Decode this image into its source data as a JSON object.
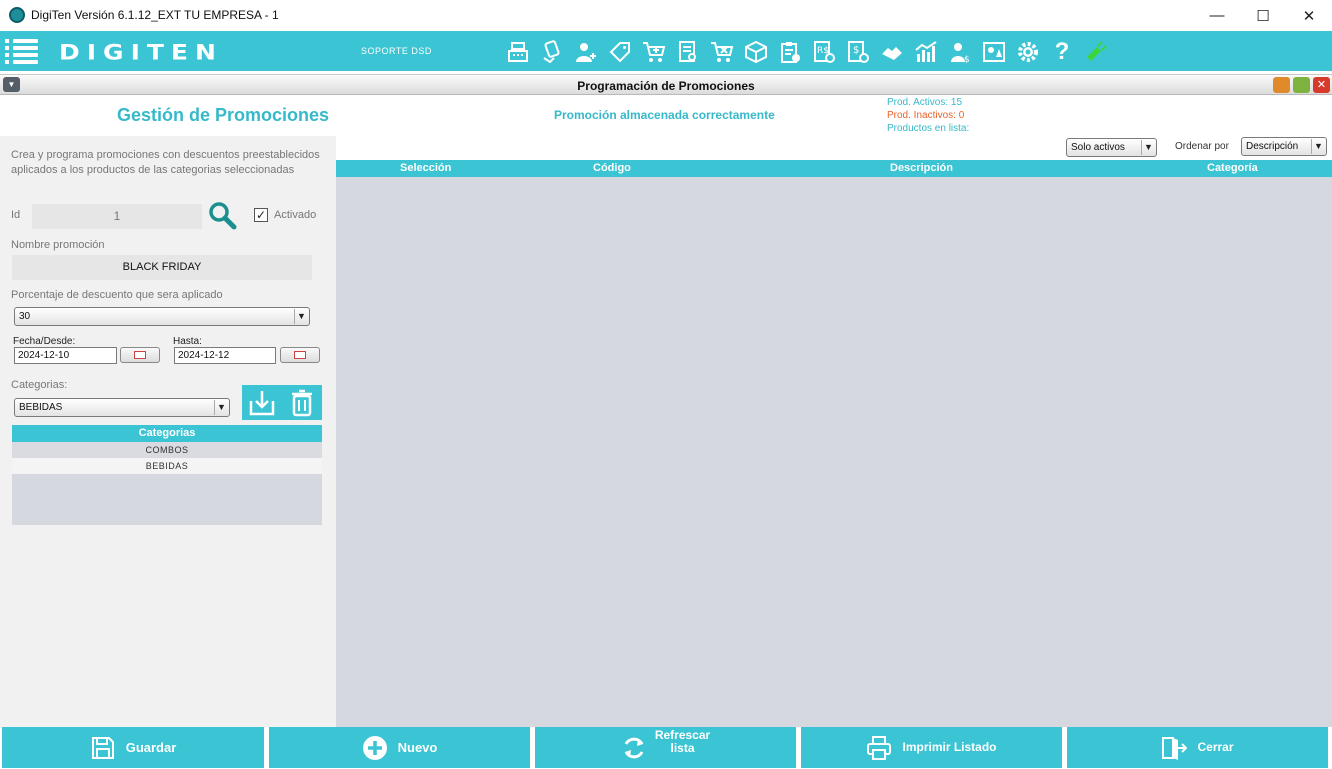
{
  "window": {
    "title": "DigiTen Versión 6.1.12_EXT TU EMPRESA - 1",
    "minimize": "—",
    "maximize": "☐",
    "close": "✕"
  },
  "toolbar": {
    "logo": "DIGITEN",
    "support": "SOPORTE DSD",
    "icons": [
      "cash-register-icon",
      "payment-icon",
      "user-add-icon",
      "tag-icon",
      "cart-add-icon",
      "invoice-search-icon",
      "cart-cancel-icon",
      "box-icon",
      "clipboard-check-icon",
      "receipt-add-icon",
      "bill-add-icon",
      "handshake-icon",
      "stats-chart-icon",
      "user-money-icon",
      "dashboard-icon",
      "gear-icon",
      "help-icon",
      "connection-icon"
    ]
  },
  "subwindow": {
    "title": "Programación de Promociones"
  },
  "left": {
    "title": "Gestión de Promociones",
    "description": "Crea y programa promociones con descuentos preestablecidos aplicados a los productos de las categorias seleccionadas",
    "id_label": "Id",
    "id_value": "1",
    "active_label": "Activado",
    "active_checked": true,
    "name_label": "Nombre promoción",
    "name_value": "BLACK FRIDAY",
    "discount_label": "Porcentaje de descuento que sera aplicado",
    "discount_value": "30",
    "from_label": "Fecha/Desde:",
    "from_value": "2024-12-10",
    "to_label": "Hasta:",
    "to_value": "2024-12-12",
    "categories_label": "Categorias:",
    "category_selected": "BEBIDAS",
    "categories_header": "Categorias",
    "categories": [
      "COMBOS",
      "BEBIDAS"
    ]
  },
  "main": {
    "status_message": "Promoción almacenada correctamente",
    "stats": {
      "active": "Prod. Activos: 15",
      "inactive": "Prod. Inactivos: 0",
      "in_list": "Productos en lista:"
    },
    "filter_value": "Solo activos",
    "order_label": "Ordenar por",
    "order_value": "Descripción",
    "columns": [
      "Selección",
      "Código",
      "Descripción",
      "Categoría"
    ]
  },
  "bottom": {
    "save": "Guardar",
    "new": "Nuevo",
    "refresh_1": "Refrescar",
    "refresh_2": "lista",
    "print": "Imprimir Listado",
    "close": "Cerrar"
  },
  "colors": {
    "accent": "#3bc4d3",
    "title_teal": "#36b9c9",
    "active_stat": "#36b9c9",
    "inactive_stat": "#e8632b",
    "search_icon": "#1a8f8f",
    "connection_icon": "#3bd63b"
  }
}
